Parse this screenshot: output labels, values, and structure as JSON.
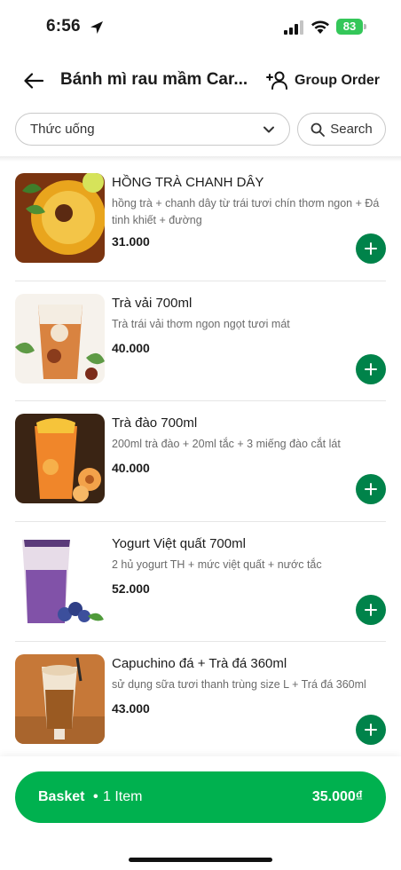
{
  "status_bar": {
    "time": "6:56",
    "battery": "83",
    "icons": [
      "location-arrow-icon",
      "signal-icon",
      "wifi-icon",
      "battery-icon"
    ]
  },
  "header": {
    "title": "Bánh mì rau mầm Car...",
    "group_order_label": "Group Order",
    "icons": [
      "back-arrow-icon",
      "group-add-icon"
    ]
  },
  "filter": {
    "category": "Thức uống",
    "search_label": "Search"
  },
  "menu": {
    "items": [
      {
        "name": "HỒNG TRÀ CHANH DÂY",
        "description": "hồng trà + chanh dây từ trái tươi chín thơm ngon + Đá tinh khiết + đường",
        "price": "31.000",
        "thumb_colors": [
          "#8a3a12",
          "#e8a41c",
          "#3f7d2a"
        ]
      },
      {
        "name": "Trà vải 700ml",
        "description": "Trà trái vải thơm ngon ngọt tươi mát",
        "price": "40.000",
        "thumb_colors": [
          "#f3efe9",
          "#d98a45",
          "#6a9a4c"
        ]
      },
      {
        "name": "Trà đào 700ml",
        "description": "200ml trà đào + 20ml tắc + 3 miếng đào cắt lát",
        "price": "40.000",
        "thumb_colors": [
          "#3a2516",
          "#f0892b",
          "#f6c63a"
        ]
      },
      {
        "name": "Yogurt Việt quất 700ml",
        "description": "2 hủ yogurt TH + mức việt quất + nước tắc",
        "price": "52.000",
        "thumb_colors": [
          "#ffffff",
          "#7b4aa8",
          "#3b4e9a"
        ]
      },
      {
        "name": "Capuchino đá + Trà đá 360ml",
        "description": "sử dụng sữa tươi thanh trùng size L + Trá đá 360ml",
        "price": "43.000",
        "thumb_colors": [
          "#c97a3a",
          "#a8642b",
          "#f2e6d4"
        ]
      }
    ]
  },
  "basket": {
    "label": "Basket",
    "separator": "•",
    "count": "1 Item",
    "total": "35.000₫"
  },
  "colors": {
    "brand_green": "#00b14f",
    "add_button_green": "#00834a"
  }
}
